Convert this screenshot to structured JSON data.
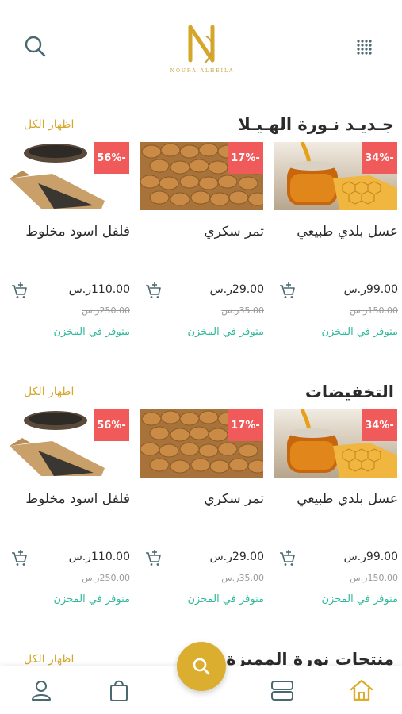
{
  "header": {
    "logo_caption": "NOURA ALHEILA"
  },
  "currency": "ر.س",
  "sections": [
    {
      "title": "جـديـد نـورة الهـيـلا",
      "show_all": "اظهار الكل",
      "products": [
        {
          "name": "عسل بلدي طبيعي",
          "price": "99.00ر.س",
          "old_price": "150.00ر.س",
          "discount": "34%-",
          "stock": "متوفر في المخزن",
          "image": "honey"
        },
        {
          "name": "تمر سكري",
          "price": "29.00ر.س",
          "old_price": "35.00ر.س",
          "discount": "17%-",
          "stock": "متوفر في المخزن",
          "image": "dates"
        },
        {
          "name": "فلفل اسود مخلوط",
          "price": "110.00ر.س",
          "old_price": "250.00ر.س",
          "discount": "56%-",
          "stock": "متوفر في المخزن",
          "image": "pepper"
        }
      ]
    },
    {
      "title": "التخفيضات",
      "show_all": "اظهار الكل",
      "products": [
        {
          "name": "عسل بلدي طبيعي",
          "price": "99.00ر.س",
          "old_price": "150.00ر.س",
          "discount": "34%-",
          "stock": "متوفر في المخزن",
          "image": "honey"
        },
        {
          "name": "تمر سكري",
          "price": "29.00ر.س",
          "old_price": "35.00ر.س",
          "discount": "17%-",
          "stock": "متوفر في المخزن",
          "image": "dates"
        },
        {
          "name": "فلفل اسود مخلوط",
          "price": "110.00ر.س",
          "old_price": "250.00ر.س",
          "discount": "56%-",
          "stock": "متوفر في المخزن",
          "image": "pepper"
        }
      ]
    },
    {
      "title": "منتجات نورة المميزة",
      "show_all": "اظهار الكل",
      "products": []
    }
  ],
  "nav": {
    "items": [
      {
        "icon": "profile-icon"
      },
      {
        "icon": "bag-icon"
      },
      {
        "icon": "categories-icon"
      },
      {
        "icon": "home-icon",
        "active": true
      }
    ],
    "fab_icon": "search-icon"
  },
  "colors": {
    "accent": "#dcae2f",
    "discount": "#f05a5a",
    "stock": "#2fb89a",
    "icon": "#4a6870"
  }
}
